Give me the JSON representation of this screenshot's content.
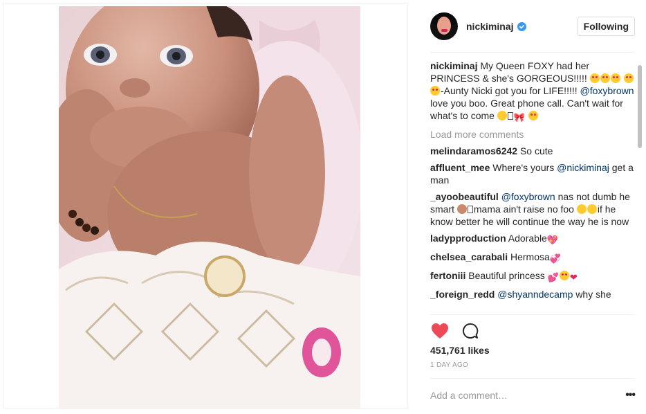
{
  "post": {
    "username": "nickiminaj",
    "follow_label": "Following",
    "caption": {
      "username": "nickiminaj",
      "text_1": "My Queen FOXY had her PRINCESS & she's GORGEOUS!!!!!",
      "text_2": "-Aunty Nicki got you for LIFE!!!!!",
      "mention": "@foxybrown",
      "text_3": "love you boo. Great phone call. Can't wait for what's to come"
    },
    "load_more": "Load more comments",
    "comments": [
      {
        "user": "melindaramos6242",
        "text": "So cute"
      },
      {
        "user": "affluent_mee",
        "text": "Where's yours",
        "mention": "@nickiminaj",
        "text_after": "get a man"
      },
      {
        "user": "_ayoobeautiful",
        "mention": "@foxybrown",
        "text": "nas not dumb he smart",
        "text_2": "mama ain't raise no foo",
        "text_3": "if he know better he will continue the way he is now"
      },
      {
        "user": "ladypproduction",
        "text": "Adorable"
      },
      {
        "user": "chelsea_carabali",
        "text": "Hermosa"
      },
      {
        "user": "fertoniii",
        "text": "Beautiful princess"
      },
      {
        "user": "_foreign_redd",
        "mention": "@shyanndecamp",
        "text": "why she"
      }
    ],
    "likes": "451,761 likes",
    "time": "1 DAY AGO",
    "comment_placeholder": "Add a comment…",
    "icons": {
      "verified": "verified-badge-icon",
      "like": "heart-icon",
      "comment": "comment-bubble-icon",
      "more": "more-options-icon"
    },
    "colors": {
      "like_red": "#ed4956",
      "mention_blue": "#003569",
      "verified_blue": "#3897f0",
      "muted": "#999999"
    }
  }
}
